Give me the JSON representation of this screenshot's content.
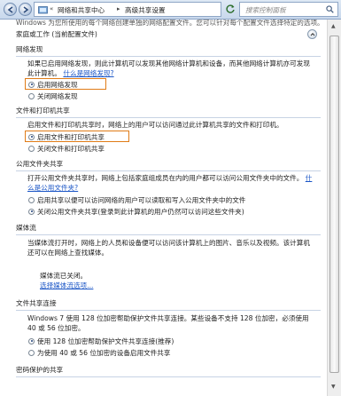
{
  "address_bar": {
    "breadcrumb_1": "网络和共享中心",
    "breadcrumb_2": "高级共享设置",
    "search_placeholder": "搜索控制面板"
  },
  "intro_text": "Windows 为您所使用的每个网络创建单独的网络配置文件。您可以针对每个配置文件选择特定的选项。",
  "profile": {
    "title": "家庭或工作 (当前配置文件)"
  },
  "network_discovery": {
    "title": "网络发现",
    "description": "如果已启用网络发现，则此计算机可以发现其他网络计算机和设备，而其他网络计算机亦可发现此计算机。",
    "link": "什么是网络发现?",
    "options": [
      "启用网络发现",
      "关闭网络发现"
    ],
    "selected": 0
  },
  "file_printer_sharing": {
    "title": "文件和打印机共享",
    "description": "启用文件和打印机共享时，网络上的用户可以访问通过此计算机共享的文件和打印机。",
    "options": [
      "启用文件和打印机共享",
      "关闭文件和打印机共享"
    ],
    "selected": 0
  },
  "public_folder_sharing": {
    "title": "公用文件夹共享",
    "description": "打开公用文件夹共享时，网络上包括家庭组成员在内的用户都可以访问公用文件夹中的文件。",
    "link_part1": "什么",
    "link_part2": "是公用文件夹?",
    "options": [
      "启用共享以便可以访问网络的用户可以读取和写入公用文件夹中的文件",
      "关闭公用文件夹共享(登录到此计算机的用户仍然可以访问这些文件夹)"
    ],
    "selected": 1
  },
  "media_streaming": {
    "title": "媒体流",
    "description": "当媒体流打开时，网络上的人员和设备便可以访问该计算机上的图片、音乐以及视频。该计算机还可以在网络上查找媒体。",
    "status": "媒体流已关闭。",
    "link": "选择媒体流选项..."
  },
  "file_sharing_connections": {
    "title": "文件共享连接",
    "description": "Windows 7 使用 128 位加密帮助保护文件共享连接。某些设备不支持 128 位加密，必须使用 40 或 56 位加密。",
    "options": [
      "使用 128 位加密帮助保护文件共享连接(推荐)",
      "为使用 40 或 56 位加密的设备启用文件共享"
    ],
    "selected": 0
  },
  "password_protected": {
    "title": "密码保护的共享"
  },
  "colors": {
    "highlight": "#e07c17",
    "link": "#1a55c6"
  }
}
